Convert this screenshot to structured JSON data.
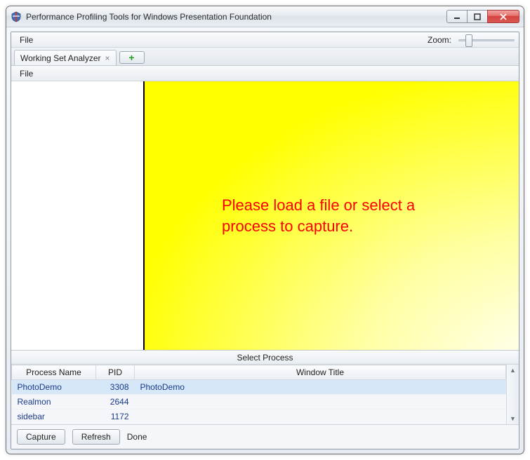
{
  "window": {
    "title": "Performance Profiling Tools for Windows Presentation Foundation"
  },
  "menubar": {
    "file": "File",
    "zoom_label": "Zoom:"
  },
  "tabs": {
    "active": "Working Set Analyzer"
  },
  "inner_menu": {
    "file": "File"
  },
  "main": {
    "placeholder": "Please load a file or select a process to capture."
  },
  "process_panel": {
    "header": "Select Process",
    "columns": {
      "name": "Process Name",
      "pid": "PID",
      "window_title": "Window Title"
    },
    "rows": [
      {
        "name": "PhotoDemo",
        "pid": "3308",
        "window_title": "PhotoDemo",
        "selected": true
      },
      {
        "name": "Realmon",
        "pid": "2644",
        "window_title": "",
        "selected": false
      },
      {
        "name": "sidebar",
        "pid": "1172",
        "window_title": "",
        "selected": false
      }
    ],
    "capture_label": "Capture",
    "refresh_label": "Refresh",
    "status": "Done"
  }
}
